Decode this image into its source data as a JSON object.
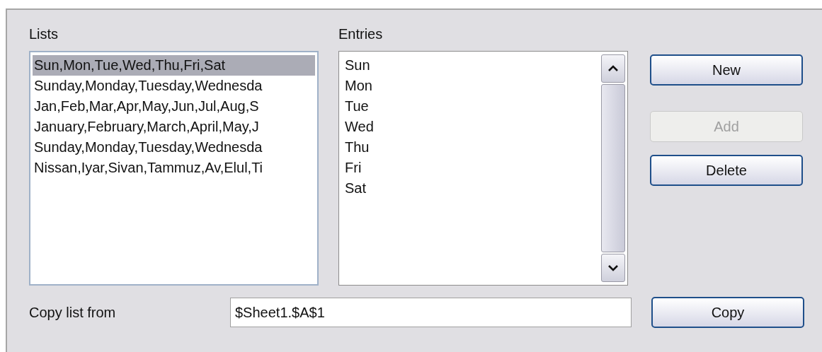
{
  "lists": {
    "label": "Lists",
    "items": [
      {
        "text": "Sun,Mon,Tue,Wed,Thu,Fri,Sat",
        "selected": true
      },
      {
        "text": "Sunday,Monday,Tuesday,Wednesda",
        "selected": false
      },
      {
        "text": "Jan,Feb,Mar,Apr,May,Jun,Jul,Aug,S",
        "selected": false
      },
      {
        "text": "January,February,March,April,May,J",
        "selected": false
      },
      {
        "text": "Sunday,Monday,Tuesday,Wednesda",
        "selected": false
      },
      {
        "text": "Nissan,Iyar,Sivan,Tammuz,Av,Elul,Ti",
        "selected": false
      }
    ]
  },
  "entries": {
    "label": "Entries",
    "items": [
      "Sun",
      "Mon",
      "Tue",
      "Wed",
      "Thu",
      "Fri",
      "Sat"
    ]
  },
  "buttons": [
    {
      "label": "New",
      "disabled": false
    },
    {
      "label": "Add",
      "disabled": true
    },
    {
      "label": "Delete",
      "disabled": false
    }
  ],
  "copy_from": {
    "label": "Copy list from",
    "value": "$Sheet1.$A$1",
    "button": "Copy"
  }
}
